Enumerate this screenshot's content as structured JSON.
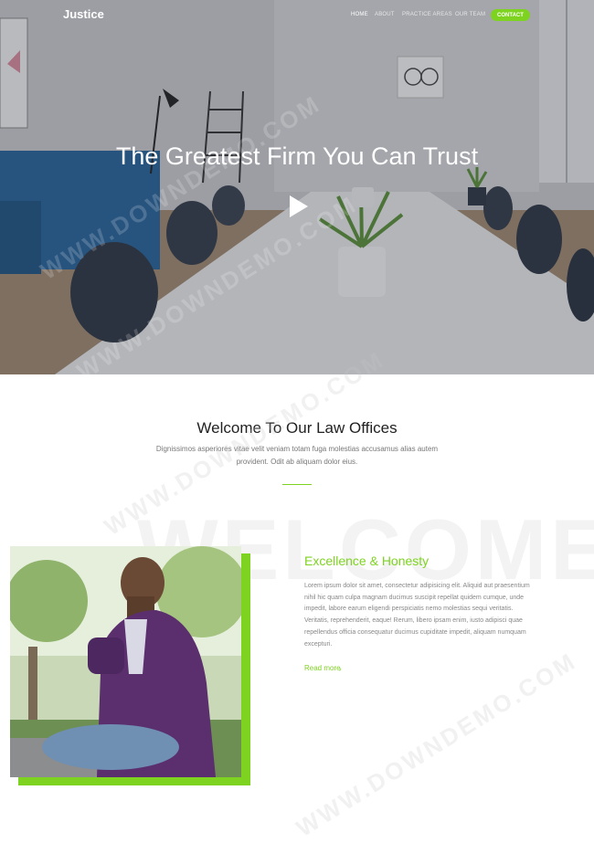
{
  "nav": {
    "brand": "Justice",
    "items": [
      "HOME",
      "ABOUT",
      "PRACTICE AREAS",
      "OUR TEAM"
    ],
    "contact_label": "CONTACT"
  },
  "hero": {
    "title": "The Greatest Firm You Can Trust"
  },
  "welcome": {
    "title": "Welcome To Our Law Offices",
    "text": "Dignissimos asperiores vitae velit veniam totam fuga molestias accusamus alias autem provident. Odit ab aliquam dolor eius.",
    "background_word": "WELCOME"
  },
  "feature": {
    "title": "Excellence & Honesty",
    "text": "Lorem ipsum dolor sit amet, consectetur adipisicing elit. Aliquid aut praesentium nihil hic quam culpa magnam ducimus suscipit repellat quidem cumque, unde impedit, labore earum eligendi perspiciatis nemo molestias sequi veritatis. Veritatis, reprehenderit, eaque! Rerum, libero ipsam enim, iusto adipisci quae repellendus officia consequatur ducimus cupiditate impedit, aliquam numquam excepturi.",
    "read_more": "Read more",
    "chevron": "›"
  },
  "watermark": {
    "text": "WWW.DOWNDEMO.COM"
  },
  "colors": {
    "accent": "#7ed321",
    "hero_overlay": "#282c37",
    "text_muted": "#777777"
  },
  "icons": {
    "play": "play-icon",
    "chevron": "chevron-right-icon"
  }
}
